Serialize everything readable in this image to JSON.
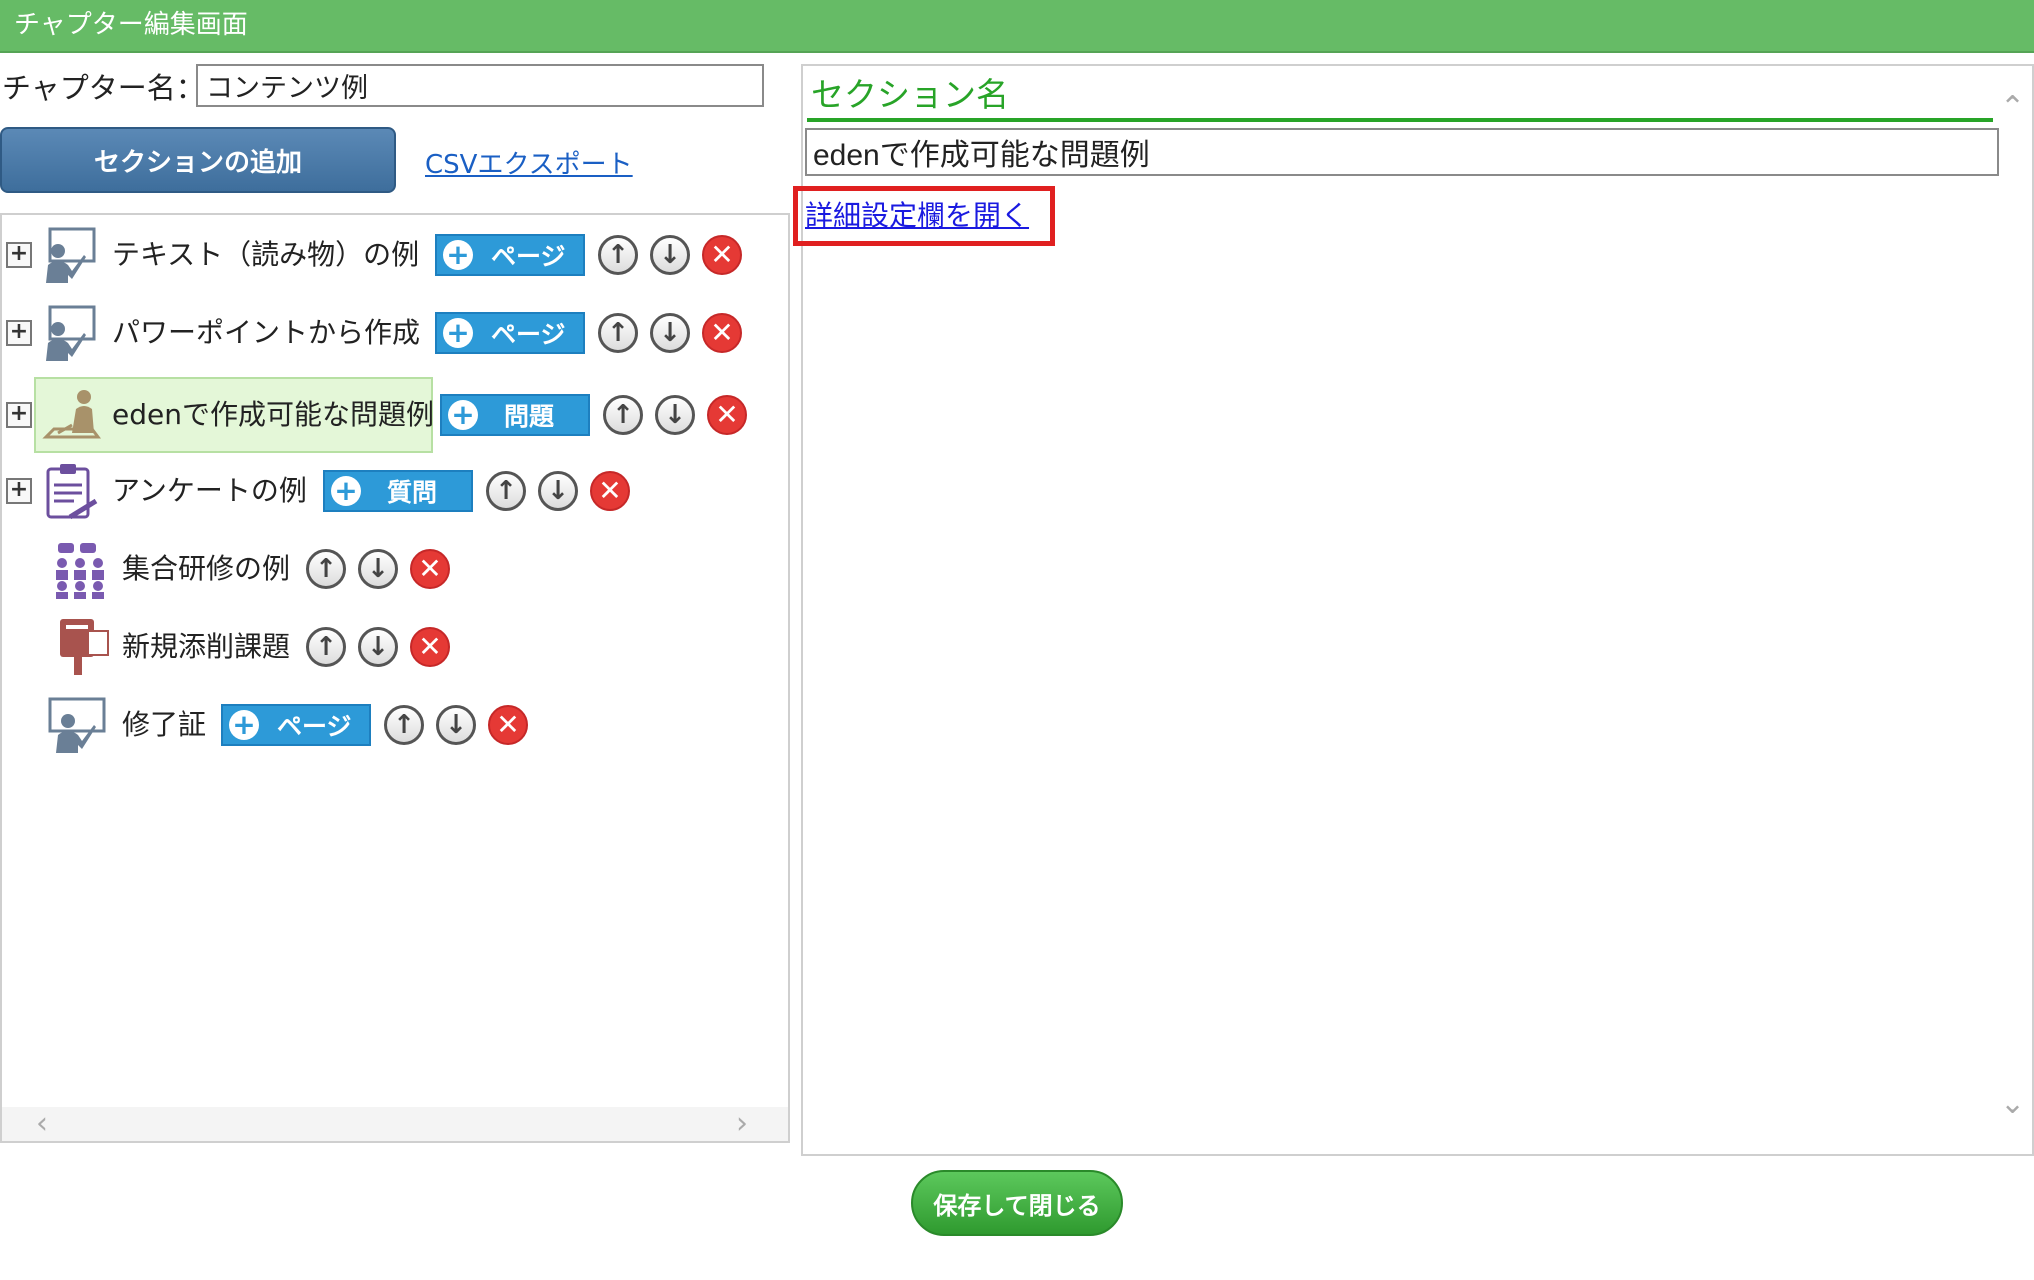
{
  "window": {
    "title": "チャプター編集画面"
  },
  "chapter": {
    "label": "チャプター名：",
    "name_value": "コンテンツ例"
  },
  "toolbar": {
    "add_section_label": "セクションの追加",
    "csv_export_label": "CSVエクスポート"
  },
  "tree": {
    "expander_symbol": "+",
    "up_symbol": "↑",
    "down_symbol": "↓",
    "delete_symbol": "✕",
    "add_symbol": "+",
    "items": [
      {
        "label": "テキスト（読み物）の例",
        "icon": "presentation-icon",
        "add_label": "ページ",
        "expandable": true,
        "selected": false
      },
      {
        "label": "パワーポイントから作成",
        "icon": "presentation-icon",
        "add_label": "ページ",
        "expandable": true,
        "selected": false
      },
      {
        "label": "edenで作成可能な問題例",
        "icon": "exam-desk-icon",
        "add_label": "問題",
        "expandable": true,
        "selected": true
      },
      {
        "label": "アンケートの例",
        "icon": "clipboard-icon",
        "add_label": "質問",
        "expandable": true,
        "selected": false
      },
      {
        "label": "集合研修の例",
        "icon": "group-training-icon",
        "expandable": false,
        "selected": false
      },
      {
        "label": "新規添削課題",
        "icon": "postbox-icon",
        "expandable": false,
        "selected": false
      },
      {
        "label": "修了証",
        "icon": "presentation-icon",
        "add_label": "ページ",
        "expandable": false,
        "selected": false
      }
    ]
  },
  "section": {
    "title": "セクション名",
    "name_value": "edenで作成可能な問題例",
    "detail_link_label": "詳細設定欄を開く"
  },
  "footer": {
    "save_close_label": "保存して閉じる"
  },
  "colors": {
    "titlebar": "#66bb66",
    "section_accent": "#28a428",
    "add_button": "#2d9ad8",
    "delete": "#e53935",
    "highlight": "#e02020"
  }
}
